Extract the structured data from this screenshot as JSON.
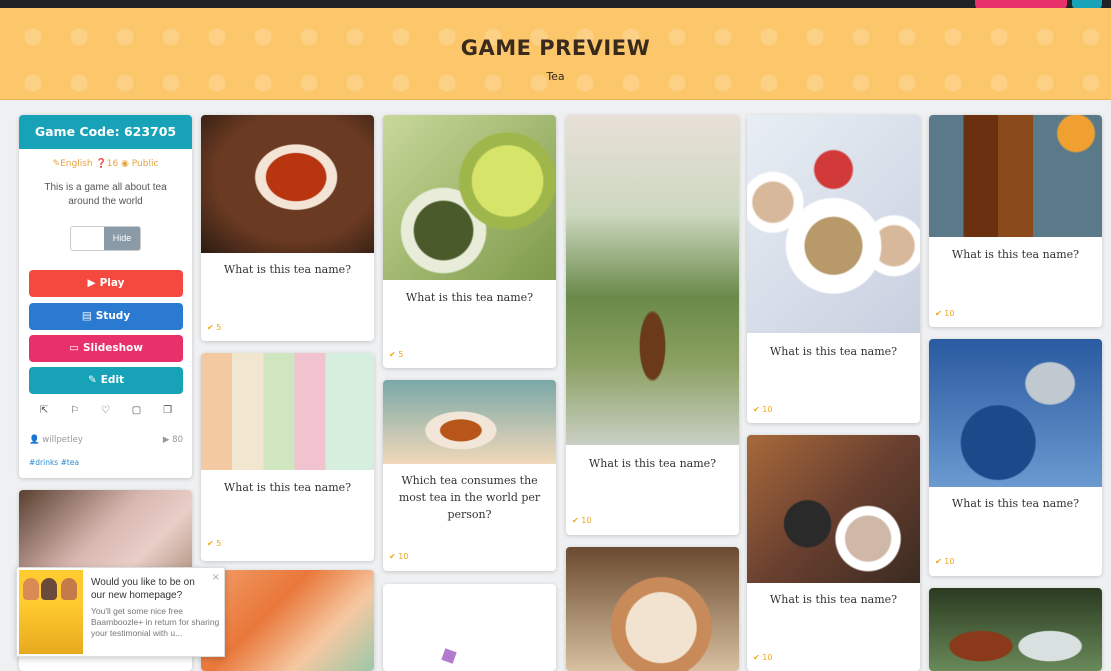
{
  "header": {
    "title": "GAME PREVIEW",
    "subtitle": "Tea"
  },
  "game": {
    "code_label": "Game Code: 623705",
    "language": "English",
    "questions": "16",
    "visibility": "Public",
    "description": "This is a game all about tea around the world",
    "toggle_label": "Hide",
    "buttons": {
      "play": "Play",
      "study": "Study",
      "slideshow": "Slideshow",
      "edit": "Edit"
    },
    "owner": "willpetley",
    "plays": "80",
    "tags": "#drinks #tea"
  },
  "cards": [
    {
      "question": "What is this tea name?",
      "points": "5"
    },
    {
      "question": "What is this tea name?",
      "points": "5"
    },
    {
      "question": "What is this tea name?",
      "points": "10"
    },
    {
      "question": "What is this tea name?",
      "points": "10"
    },
    {
      "question": "What is this tea name?",
      "points": "10"
    },
    {
      "question": "What is this tea name?",
      "points": "5"
    },
    {
      "question": "Which tea consumes the most tea in the world per person?",
      "points": "10"
    },
    {
      "question": "What is this tea name?",
      "points": "10"
    },
    {
      "question": "What is this tea name?",
      "points": "10"
    },
    {
      "question": "What is this tea name?",
      "points": "10"
    },
    {
      "question": "What is this tea name?",
      "points": ""
    }
  ],
  "popup": {
    "title": "Would you like to be on our new homepage?",
    "body": "You'll get some nice free Baamboozle+ in return for sharing your testimonial with u..."
  },
  "colors": {
    "accent": "#17a2b8",
    "play": "#f5483e",
    "study": "#2a7ad1",
    "slideshow": "#e8306a",
    "edit": "#17a2b8",
    "banner": "#fbc76a",
    "points": "#f0a61c"
  }
}
